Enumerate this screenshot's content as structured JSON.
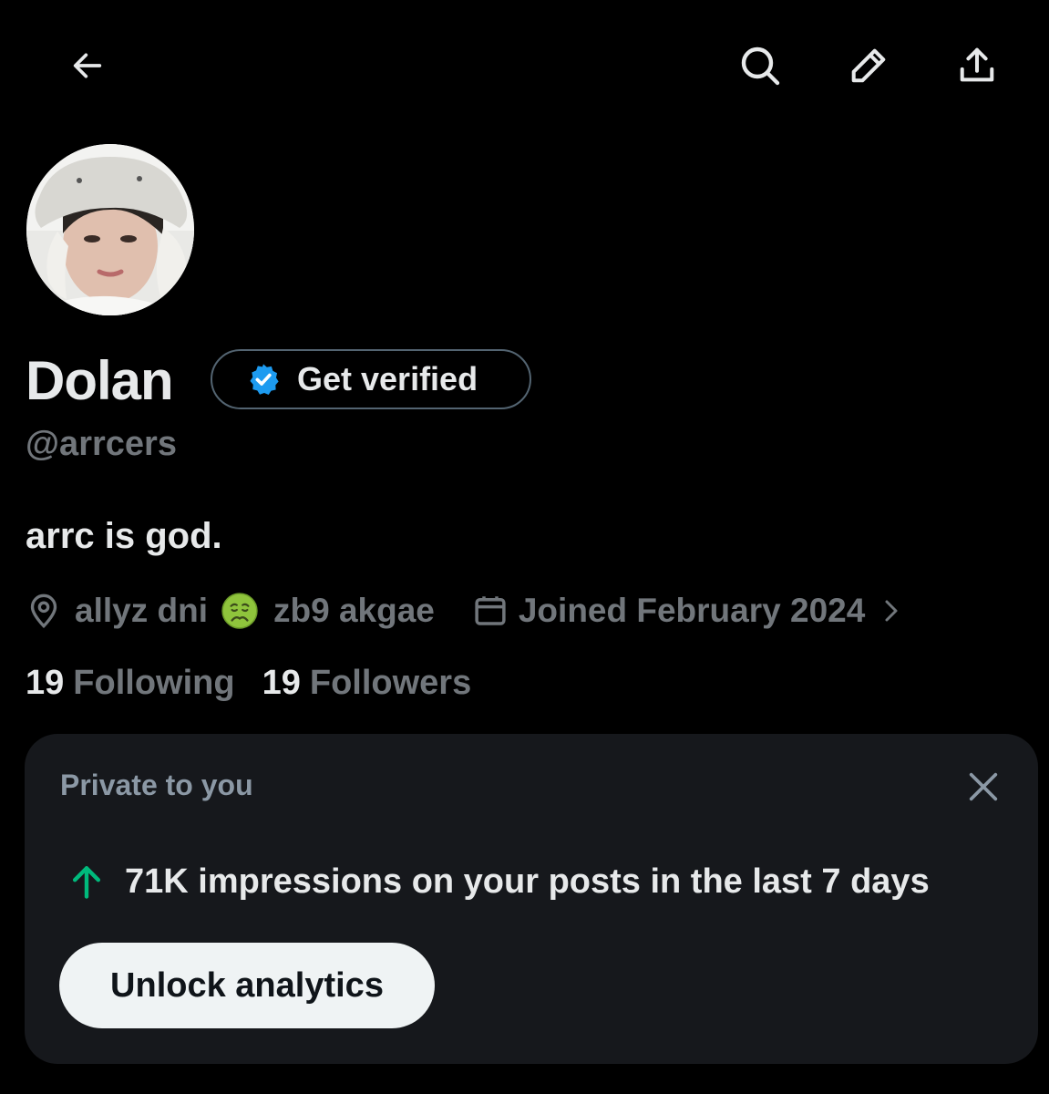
{
  "header": {
    "back_icon": "arrow-left-icon",
    "search_icon": "search-icon",
    "edit_icon": "pencil-icon",
    "share_icon": "share-upload-icon"
  },
  "profile": {
    "name": "Dolan",
    "verify_label": "Get verified",
    "handle": "@arrcers",
    "bio": "arrc is god.",
    "location_part1": "allyz dni",
    "location_emoji": "nauseated-face-emoji",
    "location_part2": "zb9 akgae",
    "joined": "Joined February 2024",
    "following_count": "19",
    "following_label": "Following",
    "followers_count": "19",
    "followers_label": "Followers"
  },
  "card": {
    "title": "Private to you",
    "impressions_text": "71K impressions on your posts in the last 7 days",
    "unlock_label": "Unlock analytics"
  },
  "colors": {
    "background": "#000000",
    "text_primary": "#e7e9ea",
    "text_secondary": "#71767b",
    "card_bg": "#16181c",
    "verified_blue": "#1d9bf0",
    "growth_green": "#00ba7c"
  }
}
